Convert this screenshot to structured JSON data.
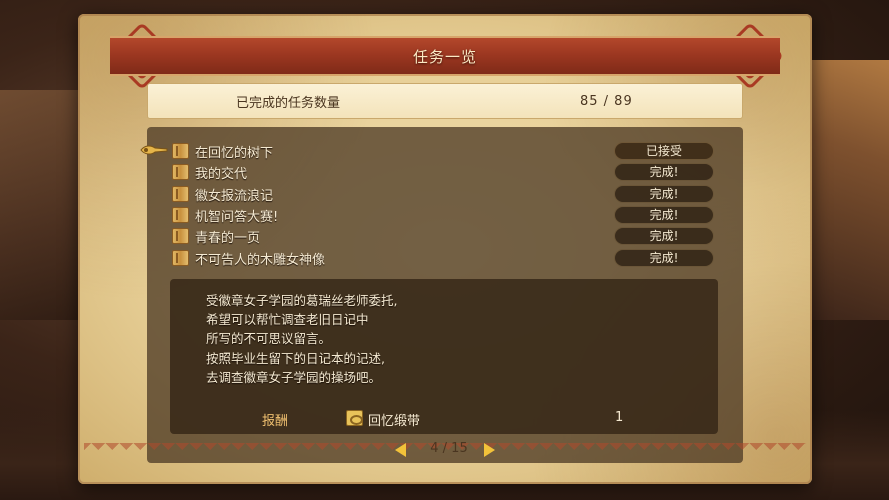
{
  "title": "任务一览",
  "summary": {
    "label": "已完成的任务数量",
    "value": "85 / 89"
  },
  "quests": [
    {
      "name": "在回忆的树下",
      "status": "已接受",
      "selected": true
    },
    {
      "name": "我的交代",
      "status": "完成!"
    },
    {
      "name": "徽女报流浪记",
      "status": "完成!"
    },
    {
      "name": "机智问答大赛!",
      "status": "完成!"
    },
    {
      "name": "青春的一页",
      "status": "完成!"
    },
    {
      "name": "不可告人的木雕女神像",
      "status": "完成!"
    }
  ],
  "description": [
    "受徽章女子学园的葛瑞丝老师委托,",
    "希望可以帮忙调查老旧日记中",
    "所写的不可思议留言。",
    "按照毕业生留下的日记本的记述,",
    "去调查徽章女子学园的操场吧。"
  ],
  "reward": {
    "label": "报酬",
    "item_icon": "ribbon-icon",
    "item_name": "回忆缎带",
    "quantity": "1"
  },
  "pager": {
    "text": "4 / 15"
  },
  "colors": {
    "banner": "#9a3620",
    "parchment": "#e7cf97",
    "accent_gold": "#f2c23a",
    "reward_label": "#f0c070"
  }
}
